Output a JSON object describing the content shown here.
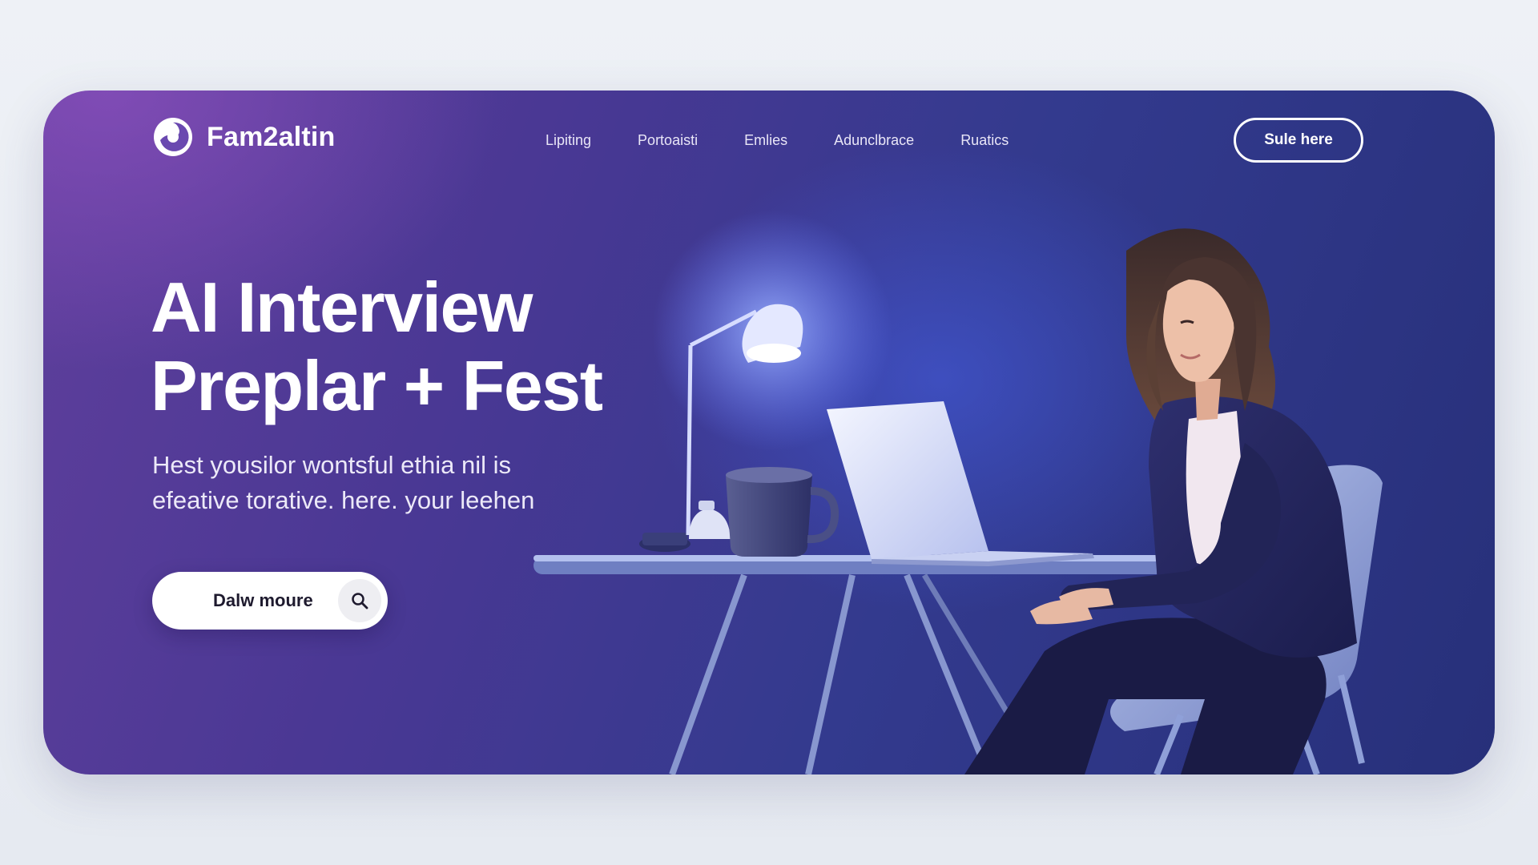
{
  "brand": {
    "name": "Fam2altin",
    "logo_icon": "swirl-logo-icon"
  },
  "nav": {
    "items": [
      {
        "label": "Lipiting"
      },
      {
        "label": "Portoaisti"
      },
      {
        "label": "Emlies"
      },
      {
        "label": "Adunclbrace"
      },
      {
        "label": "Ruatics"
      }
    ]
  },
  "header": {
    "cta_label": "Sule here"
  },
  "hero": {
    "title_line1": "AI Interview",
    "title_line2": "Preplar + Fest",
    "subtitle_line1": "Hest yousilor wontsful ethia nil is",
    "subtitle_line2": "efeative torative. here. your leehen",
    "search_label": "Dalw moure",
    "search_icon": "search-icon"
  },
  "colors": {
    "card_gradient_start": "#5f3f9c",
    "card_gradient_end": "#27307a",
    "accent_text": "#ffffff",
    "page_background": "#eef1f6"
  }
}
